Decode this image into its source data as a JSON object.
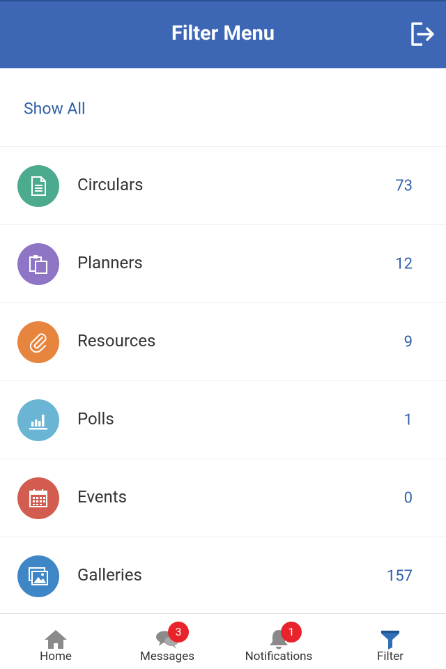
{
  "header": {
    "title": "Filter Menu",
    "logout_icon": "logout-icon"
  },
  "show_all": {
    "label": "Show All"
  },
  "categories": [
    {
      "label": "Circulars",
      "count": "73",
      "color": "#4caa8e",
      "icon": "document-icon"
    },
    {
      "label": "Planners",
      "count": "12",
      "color": "#8e75c6",
      "icon": "clipboard-icon"
    },
    {
      "label": "Resources",
      "count": "9",
      "color": "#e7843e",
      "icon": "paperclip-icon"
    },
    {
      "label": "Polls",
      "count": "1",
      "color": "#6ab5d4",
      "icon": "bar-chart-icon"
    },
    {
      "label": "Events",
      "count": "0",
      "color": "#d25c4f",
      "icon": "calendar-icon"
    },
    {
      "label": "Galleries",
      "count": "157",
      "color": "#3e86c5",
      "icon": "image-icon"
    }
  ],
  "tabbar": {
    "items": [
      {
        "label": "Home",
        "icon": "home-icon"
      },
      {
        "label": "Messages",
        "icon": "chat-icon",
        "badge": "3"
      },
      {
        "label": "Notifications",
        "icon": "bell-icon",
        "badge": "1"
      },
      {
        "label": "Filter",
        "icon": "filter-icon",
        "active_color": "#2f6db5"
      }
    ]
  }
}
